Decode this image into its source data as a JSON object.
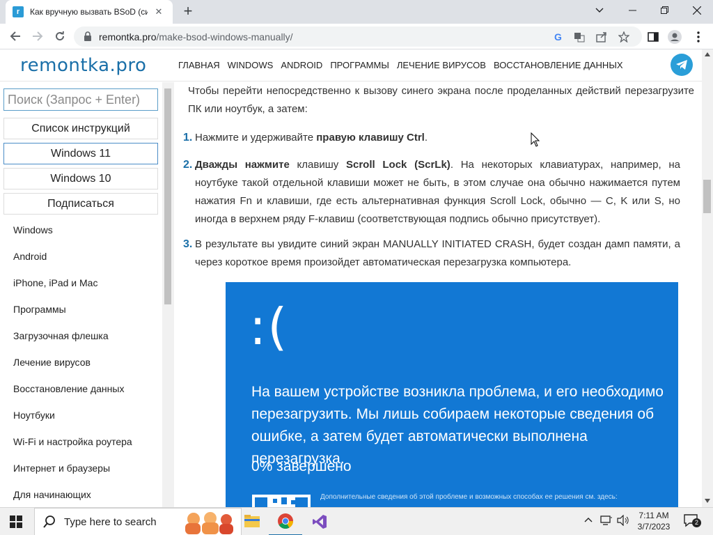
{
  "browser": {
    "tab": {
      "title": "Как вручную вызвать BSoD (си",
      "favicon": "r"
    },
    "address": {
      "domain": "remontka.pro",
      "path": "/make-bsod-windows-manually/"
    }
  },
  "site": {
    "logo": "remontka.pro",
    "nav": [
      "ГЛАВНАЯ",
      "WINDOWS",
      "ANDROID",
      "ПРОГРАММЫ",
      "ЛЕЧЕНИЕ ВИРУСОВ",
      "ВОССТАНОВЛЕНИЕ ДАННЫХ"
    ]
  },
  "sidebar": {
    "search_placeholder": "Поиск (Запрос + Enter)",
    "buttons": [
      "Список инструкций",
      "Windows 11",
      "Windows 10",
      "Подписаться"
    ],
    "links": [
      "Windows",
      "Android",
      "iPhone, iPad и Mac",
      "Программы",
      "Загрузочная флешка",
      "Лечение вирусов",
      "Восстановление данных",
      "Ноутбуки",
      "Wi-Fi и настройка роутера",
      "Интернет и браузеры",
      "Для начинающих"
    ]
  },
  "article": {
    "intro": "Чтобы перейти непосредственно к вызову синего экрана после проделанных действий перезагрузите ПК или ноутбук, а затем:",
    "steps": [
      {
        "num": "1.",
        "pre": "Нажмите и удерживайте ",
        "bold": "правую клавишу Ctrl",
        "post": "."
      },
      {
        "num": "2.",
        "bold1": "Дважды нажмите",
        "mid": " клавишу ",
        "bold2": "Scroll Lock (ScrLk)",
        "post": ". На некоторых клавиатурах, например, на ноутбуке такой отдельной клавиши может не быть, в этом случае она обычно нажимается путем нажатия Fn и клавиши, где есть альтернативная функция Scroll Lock, обычно — C, K или S, но иногда в верхнем ряду F-клавиш (соответствующая подпись обычно присутствует)."
      },
      {
        "num": "3.",
        "text": "В результате вы увидите синий экран MANUALLY INITIATED CRASH, будет создан дамп памяти, а через короткое время произойдет автоматическая перезагрузка компьютера."
      }
    ],
    "bsod": {
      "face": ":(",
      "message": "На вашем устройстве возникла проблема, и его необходимо перезагрузить. Мы лишь собираем некоторые сведения об ошибке, а затем будет автоматически выполнена перезагрузка.",
      "progress": "0% завершено",
      "more_info": "Дополнительные сведения об этой проблеме и возможных способах ее решения см. здесь:"
    }
  },
  "taskbar": {
    "search_text": "Type here to search",
    "time": "7:11 AM",
    "date": "3/7/2023",
    "notifications": "2"
  },
  "colors": {
    "accent": "#1a6fa8",
    "bsod": "#1278d4",
    "telegram": "#2a9ed8"
  }
}
